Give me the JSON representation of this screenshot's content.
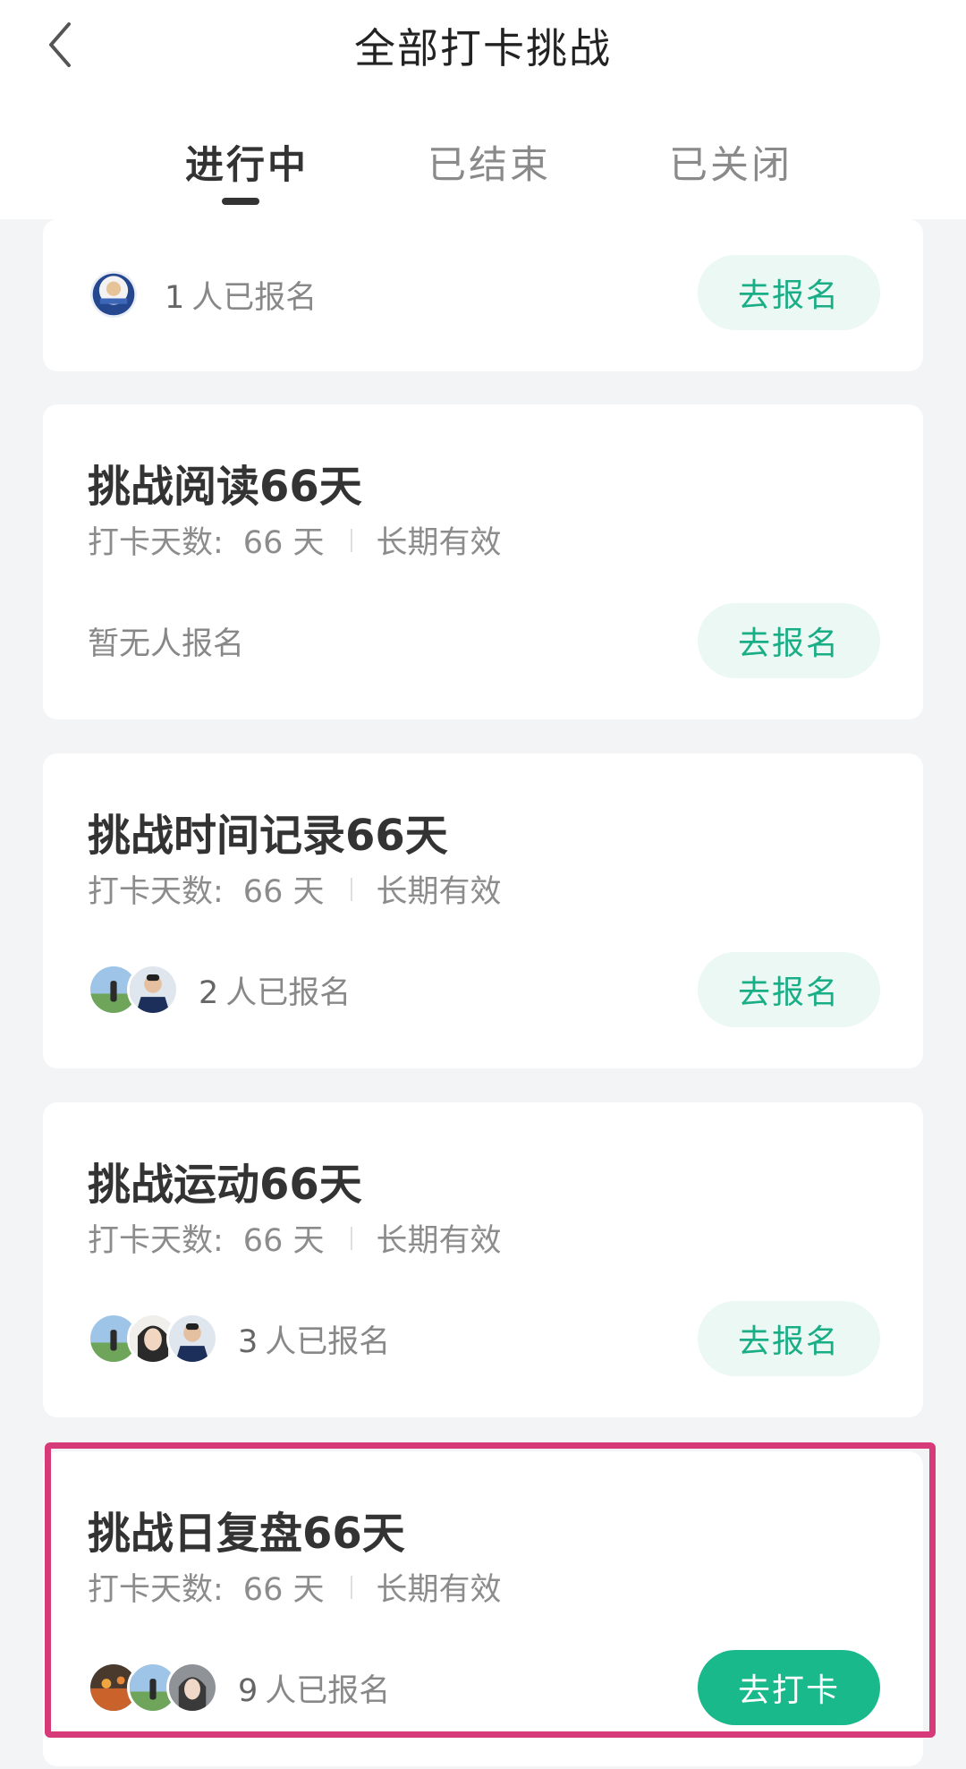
{
  "header": {
    "title": "全部打卡挑战",
    "back_icon": "chevron-left-icon"
  },
  "tabs": [
    {
      "label": "进行中",
      "active": true
    },
    {
      "label": "已结束",
      "active": false
    },
    {
      "label": "已关闭",
      "active": false
    }
  ],
  "challenges": [
    {
      "enroll_count": "1",
      "enroll_suffix": "人已报名",
      "action": "去报名"
    },
    {
      "title": "挑战阅读66天",
      "days_label": "打卡天数:",
      "days_value": "66 天",
      "validity": "长期有效",
      "enroll_text": "暂无人报名",
      "action": "去报名"
    },
    {
      "title": "挑战时间记录66天",
      "days_label": "打卡天数:",
      "days_value": "66 天",
      "validity": "长期有效",
      "enroll_count": "2",
      "enroll_suffix": "人已报名",
      "action": "去报名"
    },
    {
      "title": "挑战运动66天",
      "days_label": "打卡天数:",
      "days_value": "66 天",
      "validity": "长期有效",
      "enroll_count": "3",
      "enroll_suffix": "人已报名",
      "action": "去报名"
    },
    {
      "title": "挑战日复盘66天",
      "days_label": "打卡天数:",
      "days_value": "66 天",
      "validity": "长期有效",
      "enroll_count": "9",
      "enroll_suffix": "人已报名",
      "action": "去打卡"
    }
  ],
  "colors": {
    "accent": "#1ab98c",
    "accent_light": "#ebf8f3",
    "highlight": "#d63a78",
    "background": "#f3f4f6"
  }
}
